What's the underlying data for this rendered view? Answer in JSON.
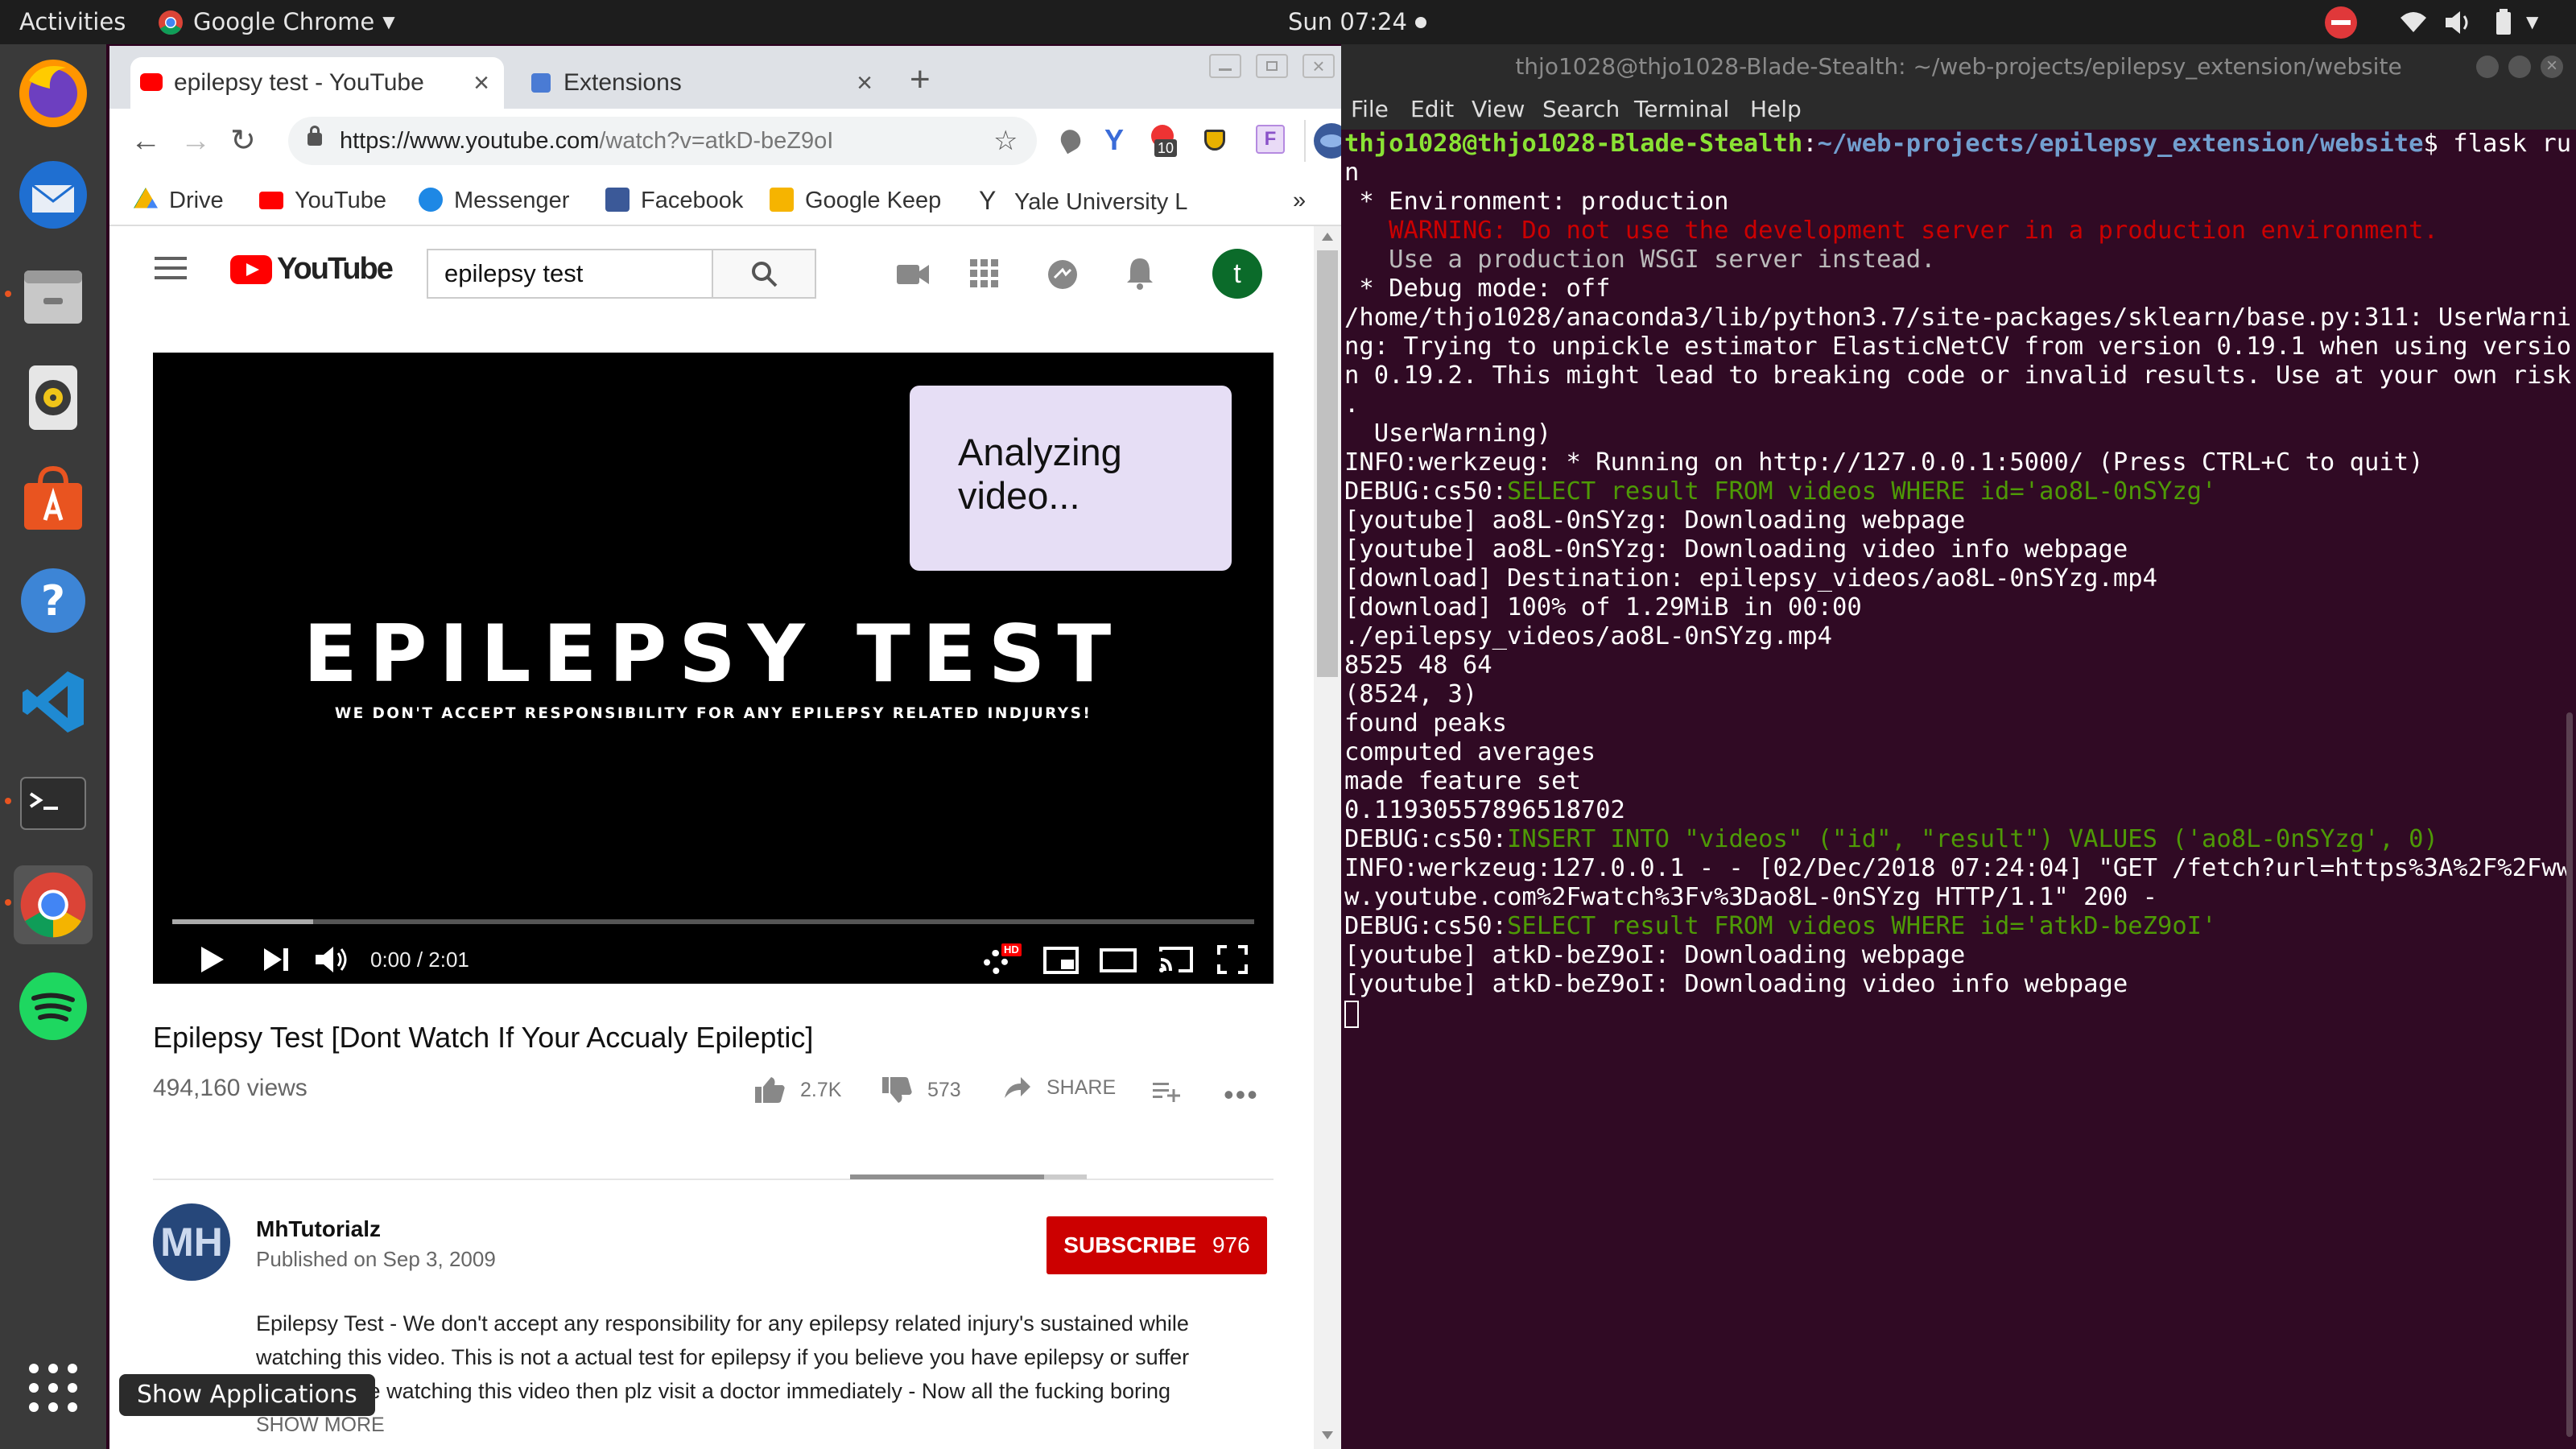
{
  "topbar": {
    "activities": "Activities",
    "app_name": "Google Chrome",
    "clock": "Sun 07:24"
  },
  "dock": {
    "tooltip": "Show Applications"
  },
  "browser": {
    "tabs": [
      {
        "label": "epilepsy test - YouTube"
      },
      {
        "label": "Extensions"
      }
    ],
    "url_domain": "https://www.youtube.com",
    "url_path": "/watch?v=atkD-beZ9oI",
    "extension_badge": "10",
    "avatar_letter": "t",
    "bookmarks": [
      "Drive",
      "YouTube",
      "Messenger",
      "Facebook",
      "Google Keep",
      "Yale University L"
    ],
    "bookmarks_more": "»"
  },
  "youtube": {
    "logo_text": "YouTube",
    "search_value": "epilepsy test",
    "avatar_letter": "t",
    "video_title_big": "EPILEPSY TEST",
    "video_subtitle": "WE DON'T ACCEPT RESPONSIBILITY FOR ANY EPILEPSY RELATED INDJURYS!",
    "overlay": "Analyzing video...",
    "time": "0:00 / 2:01",
    "progress_fraction": 0.0,
    "buffered_fraction": 0.13,
    "title": "Epilepsy Test [Dont Watch If Your Accualy Epileptic]",
    "views": "494,160 views",
    "likes": "2.7K",
    "dislikes": "573",
    "like_ratio": 0.82,
    "share": "SHARE",
    "channel_initials": "MH",
    "channel": "MhTutorialz",
    "published": "Published on Sep 3, 2009",
    "subscribe": "SUBSCRIBE",
    "subs": "976",
    "description": [
      "Epilepsy Test - We don't accept any responsibility for any epilepsy related injury's sustained while",
      "watching this video.  This is not a actual test for epilepsy if you believe you have epilepsy or suffer",
      "any fits while watching this video then plz visit a doctor immediately   - Now all the fucking boring"
    ],
    "show_more": "SHOW MORE"
  },
  "terminal": {
    "title": "thjo1028@thjo1028-Blade-Stealth: ~/web-projects/epilepsy_extension/website",
    "menu": [
      "File",
      "Edit",
      "View",
      "Search",
      "Terminal",
      "Help"
    ],
    "prompt_user": "thjo1028@thjo1028-Blade-Stealth",
    "prompt_path": "~/web-projects/epilepsy_extension/website",
    "prompt_cmd": "$ flask ru",
    "l1": "n",
    "l2": " * Environment: production",
    "l3": "   WARNING: Do not use the development server in a production environment.",
    "l4": "   Use a production WSGI server instead.",
    "l5": " * Debug mode: off",
    "l6": "/home/thjo1028/anaconda3/lib/python3.7/site-packages/sklearn/base.py:311: UserWarni",
    "l7": "ng: Trying to unpickle estimator ElasticNetCV from version 0.19.1 when using versio",
    "l8": "n 0.19.2. This might lead to breaking code or invalid results. Use at your own risk",
    "l9": ".",
    "l10": "  UserWarning)",
    "l11": "INFO:werkzeug: * Running on http://127.0.0.1:5000/ (Press CTRL+C to quit)",
    "l12a": "DEBUG:cs50:",
    "l12b": "SELECT result FROM videos WHERE id='ao8L-0nSYzg'",
    "l13": "[youtube] ao8L-0nSYzg: Downloading webpage",
    "l14": "[youtube] ao8L-0nSYzg: Downloading video info webpage",
    "l15": "[download] Destination: epilepsy_videos/ao8L-0nSYzg.mp4",
    "l16": "[download] 100% of 1.29MiB in 00:00",
    "l17": "./epilepsy_videos/ao8L-0nSYzg.mp4",
    "l18": "8525 48 64",
    "l19": "(8524, 3)",
    "l20": "found peaks",
    "l21": "computed averages",
    "l22": "made feature set",
    "l23": "0.11930557896518702",
    "l24a": "DEBUG:cs50:",
    "l24b": "INSERT INTO \"videos\" (\"id\", \"result\") VALUES ('ao8L-0nSYzg', 0)",
    "l25": "INFO:werkzeug:127.0.0.1 - - [02/Dec/2018 07:24:04] \"GET /fetch?url=https%3A%2F%2Fww",
    "l26": "w.youtube.com%2Fwatch%3Fv%3Dao8L-0nSYzg HTTP/1.1\" 200 -",
    "l27a": "DEBUG:cs50:",
    "l27b": "SELECT result FROM videos WHERE id='atkD-beZ9oI'",
    "l28": "[youtube] atkD-beZ9oI: Downloading webpage",
    "l29": "[youtube] atkD-beZ9oI: Downloading video info webpage"
  },
  "colors": {
    "ubuntu_orange": "#e95420",
    "terminal_bg": "#300a24",
    "youtube_red": "#ff0000",
    "subscribe_red": "#cc0000",
    "term_green": "#4e9a06",
    "term_red": "#cc0000",
    "prompt_green": "#8ae234",
    "prompt_blue": "#729fcf"
  }
}
